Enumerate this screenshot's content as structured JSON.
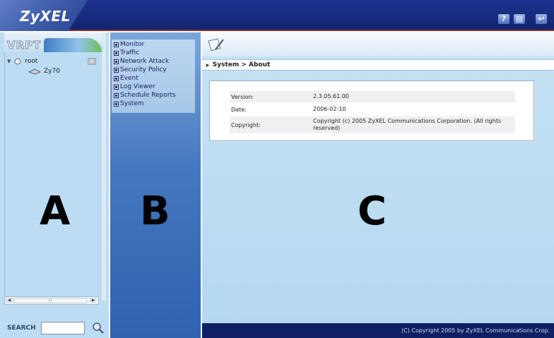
{
  "header": {
    "logo": "ZyXEL",
    "icons": [
      {
        "name": "help-icon",
        "glyph": "?"
      },
      {
        "name": "notes-icon",
        "glyph": "▤"
      },
      {
        "name": "logout-icon",
        "glyph": "↩"
      }
    ]
  },
  "panel_a": {
    "logo": "VRPT",
    "tree": {
      "root": "root",
      "child": "Zy70"
    },
    "scroll_thumb": "|||",
    "search_label": "SEARCH",
    "search_value": ""
  },
  "panel_b": {
    "menu": [
      "Monitor",
      "Traffic",
      "Network Attack",
      "Security Policy",
      "Event",
      "Log Viewer",
      "Schedule Reports",
      "System"
    ]
  },
  "panel_c": {
    "breadcrumb": "System > About",
    "about": [
      {
        "label": "Version:",
        "value": "2.3.05.61.00"
      },
      {
        "label": "Date:",
        "value": "2006-02-10"
      },
      {
        "label": "Copyright:",
        "value": "Copyright (c) 2005 ZyXEL Communications Corporation. (All rights reserved)"
      }
    ],
    "footer": "(C) Copyright 2005 by ZyXEL Communications Crop."
  },
  "labels": {
    "a": "A",
    "b": "B",
    "c": "C"
  },
  "colors": {
    "header": "#13256f",
    "panel_a": "#bcdcf3",
    "panel_b": "#4477bf",
    "panel_c": "#b4d7ef",
    "footer": "#0f1f63"
  }
}
